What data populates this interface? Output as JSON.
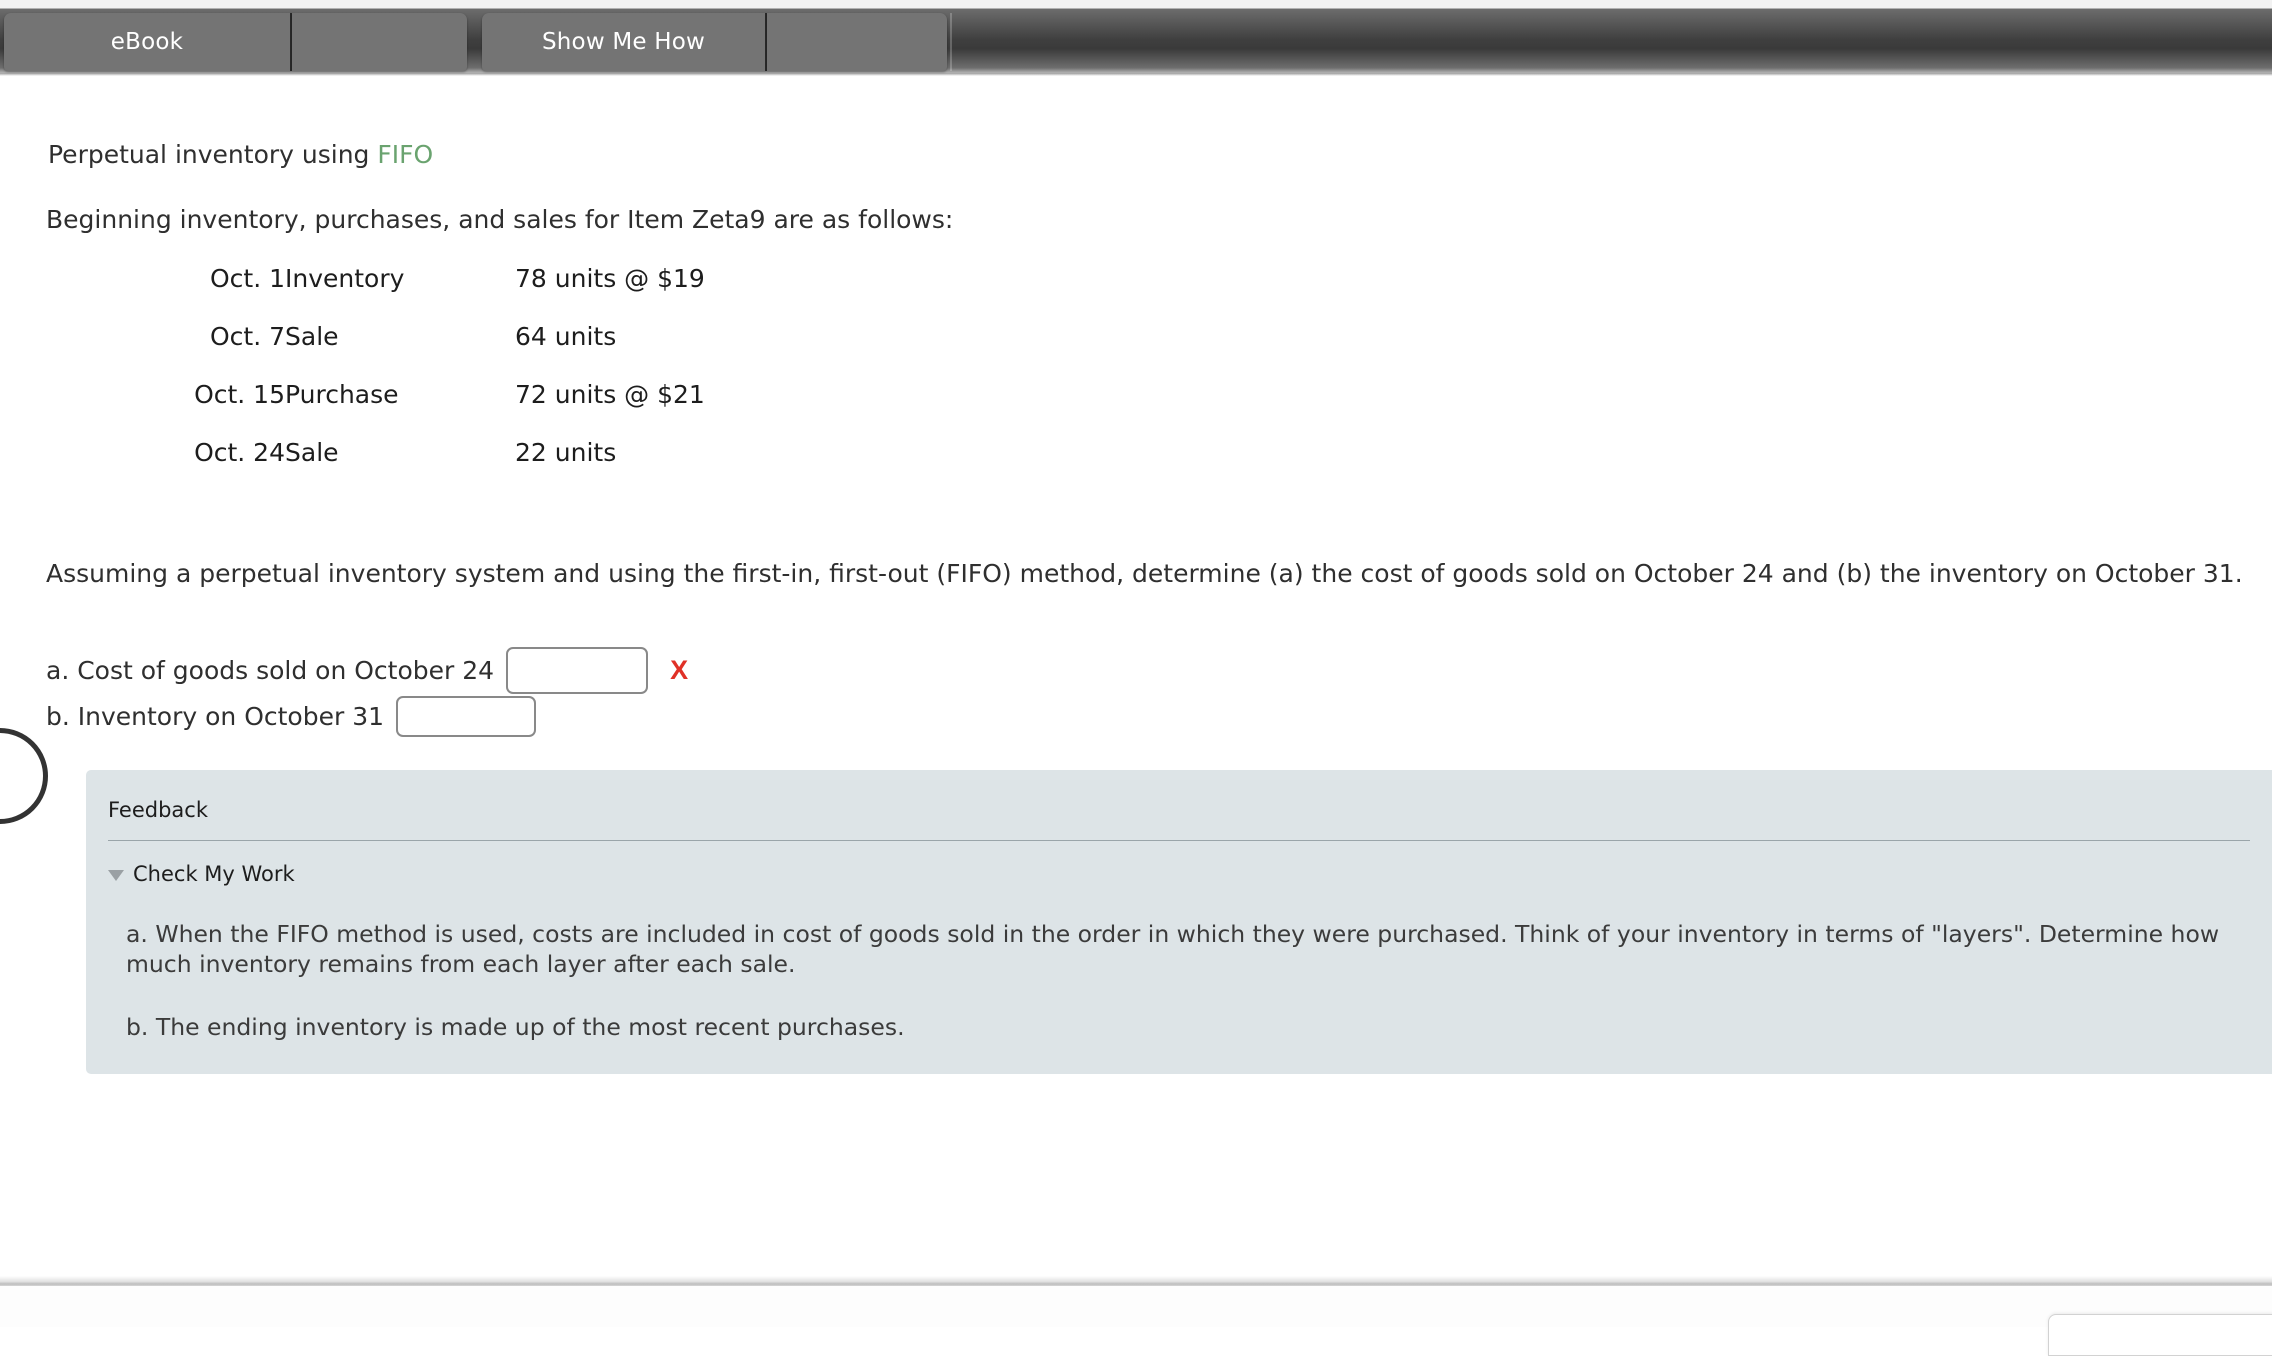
{
  "toolbar": {
    "tabs": [
      {
        "name": "ebook",
        "label": "eBook"
      },
      {
        "name": "ebook-extra",
        "label": ""
      },
      {
        "name": "show-me-how",
        "label": "Show Me How"
      },
      {
        "name": "show-me-how-extra",
        "label": ""
      }
    ]
  },
  "question": {
    "title_prefix": "Perpetual inventory using ",
    "title_accent": "FIFO",
    "accent_color": "#6aa36f",
    "intro": "Beginning inventory, purchases, and sales for Item Zeta9 are as follows:",
    "transactions": [
      {
        "date": "Oct. 1",
        "description": "Inventory",
        "amount": "78 units @ $19"
      },
      {
        "date": "Oct. 7",
        "description": "Sale",
        "amount": "64 units"
      },
      {
        "date": "Oct. 15",
        "description": "Purchase",
        "amount": "72 units @ $21"
      },
      {
        "date": "Oct. 24",
        "description": "Sale",
        "amount": "22 units"
      }
    ],
    "instruction": "Assuming a perpetual inventory system and using the first-in, first-out (FIFO) method, determine (a) the cost of goods sold on October 24 and (b) the inventory on October 31."
  },
  "answers": {
    "a": {
      "label": "a. Cost of goods sold on October 24",
      "value": "",
      "placeholder": "",
      "mark": "X",
      "mark_color": "#e03127"
    },
    "b": {
      "label": "b. Inventory on October 31",
      "value": "",
      "placeholder": ""
    }
  },
  "feedback": {
    "title": "Feedback",
    "toggle_label": "Check My Work",
    "paragraphs": [
      "a. When the FIFO method is used, costs are included in cost of goods sold in the order in which they were purchased. Think of your inventory in terms of \"layers\". Determine how much inventory remains from each layer after each sale.",
      "b. The ending inventory is made up of the most recent purchases."
    ]
  }
}
